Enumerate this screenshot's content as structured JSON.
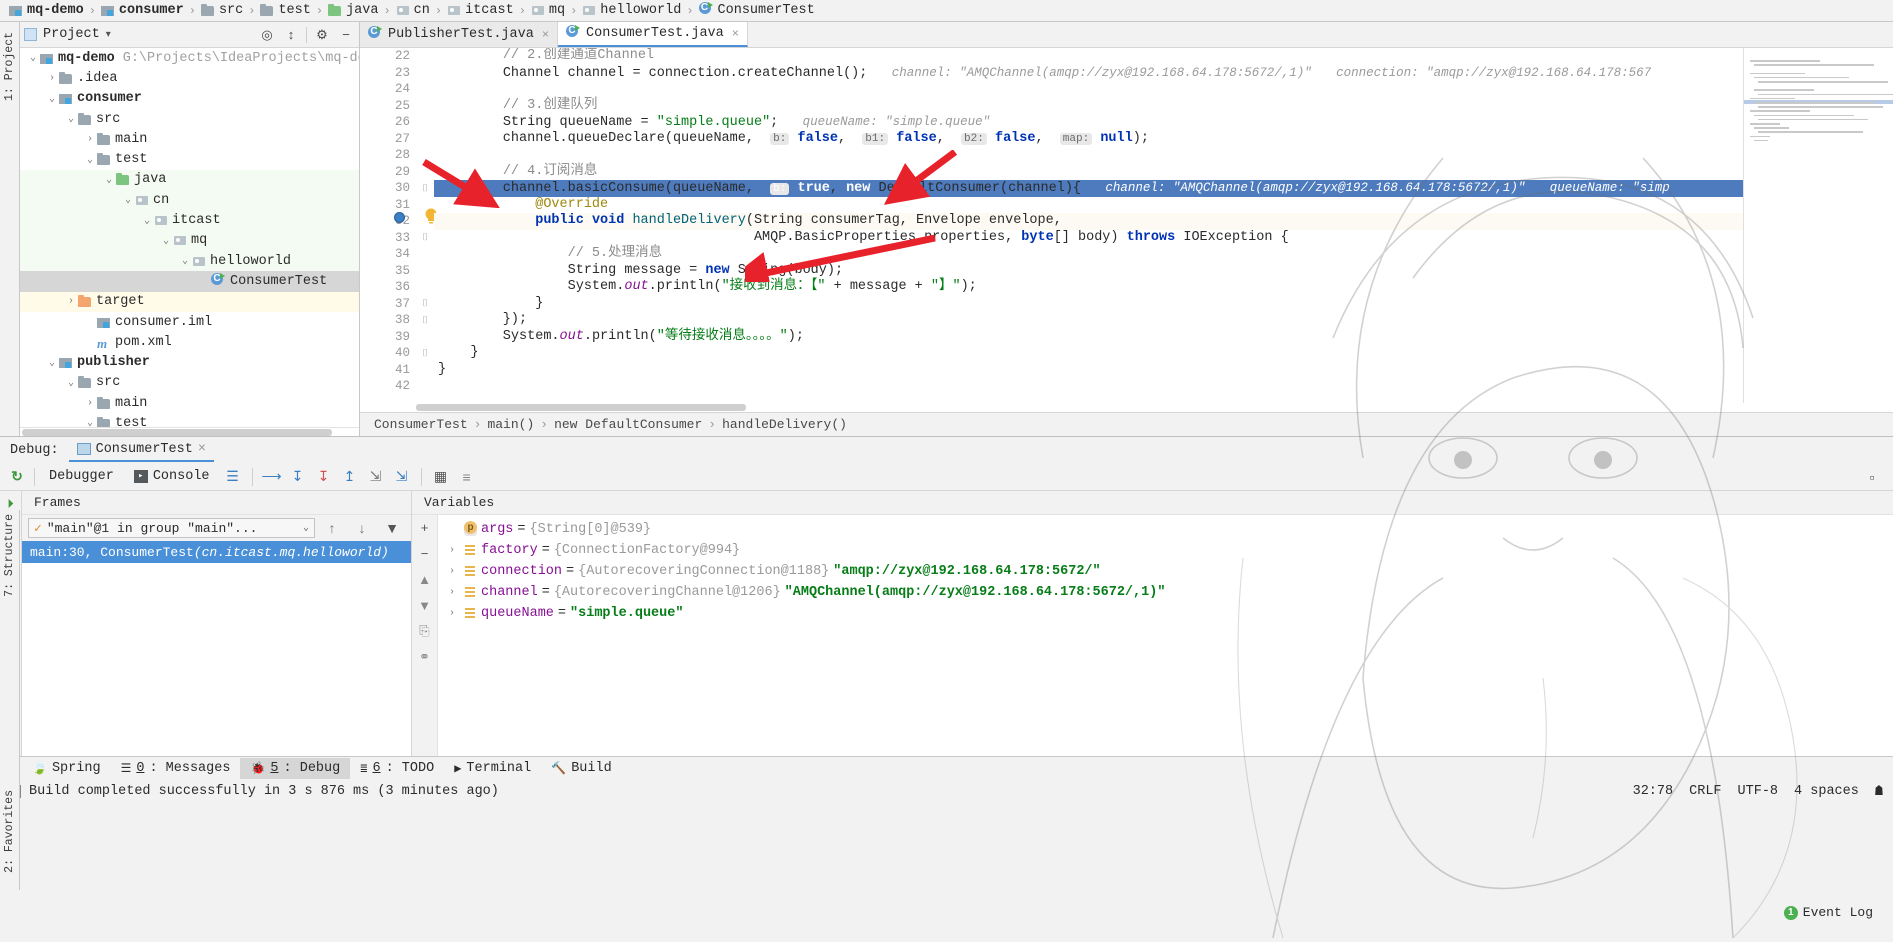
{
  "navbar": {
    "crumbs": [
      {
        "label": "mq-demo",
        "icon": "module-icon",
        "bold": true
      },
      {
        "label": "consumer",
        "icon": "module-icon",
        "bold": true
      },
      {
        "label": "src",
        "icon": "folder-icon",
        "bold": false
      },
      {
        "label": "test",
        "icon": "folder-icon",
        "bold": false
      },
      {
        "label": "java",
        "icon": "folder-green-icon",
        "bold": false
      },
      {
        "label": "cn",
        "icon": "package-icon",
        "bold": false
      },
      {
        "label": "itcast",
        "icon": "package-icon",
        "bold": false
      },
      {
        "label": "mq",
        "icon": "package-icon",
        "bold": false
      },
      {
        "label": "helloworld",
        "icon": "package-icon",
        "bold": false
      },
      {
        "label": "ConsumerTest",
        "icon": "java-class-icon",
        "bold": false
      }
    ],
    "separator": "›"
  },
  "left_strips": {
    "project_label": "1: Project",
    "structure_label": "7: Structure",
    "favorites_label": "2: Favorites"
  },
  "project_panel": {
    "title": "Project",
    "dropdown_caret": "▾",
    "tree": [
      {
        "indent": 0,
        "arrow": "⌄",
        "icon": "module-icon",
        "label": "mq-demo",
        "bold": true,
        "path": "G:\\Projects\\IdeaProjects\\mq-demo",
        "state": "normal"
      },
      {
        "indent": 1,
        "arrow": "›",
        "icon": "folder-icon",
        "label": ".idea",
        "bold": false,
        "path": "",
        "state": "normal"
      },
      {
        "indent": 1,
        "arrow": "⌄",
        "icon": "module-icon",
        "label": "consumer",
        "bold": true,
        "path": "",
        "state": "normal"
      },
      {
        "indent": 2,
        "arrow": "⌄",
        "icon": "folder-icon",
        "label": "src",
        "bold": false,
        "path": "",
        "state": "normal"
      },
      {
        "indent": 3,
        "arrow": "›",
        "icon": "folder-icon",
        "label": "main",
        "bold": false,
        "path": "",
        "state": "normal"
      },
      {
        "indent": 3,
        "arrow": "⌄",
        "icon": "folder-icon",
        "label": "test",
        "bold": false,
        "path": "",
        "state": "normal"
      },
      {
        "indent": 4,
        "arrow": "⌄",
        "icon": "folder-green-icon",
        "label": "java",
        "bold": false,
        "path": "",
        "state": "src"
      },
      {
        "indent": 5,
        "arrow": "⌄",
        "icon": "package-icon",
        "label": "cn",
        "bold": false,
        "path": "",
        "state": "src"
      },
      {
        "indent": 6,
        "arrow": "⌄",
        "icon": "package-icon",
        "label": "itcast",
        "bold": false,
        "path": "",
        "state": "src"
      },
      {
        "indent": 7,
        "arrow": "⌄",
        "icon": "package-icon",
        "label": "mq",
        "bold": false,
        "path": "",
        "state": "src"
      },
      {
        "indent": 8,
        "arrow": "⌄",
        "icon": "package-icon",
        "label": "helloworld",
        "bold": false,
        "path": "",
        "state": "src"
      },
      {
        "indent": 9,
        "arrow": "",
        "icon": "java-class-icon",
        "label": "ConsumerTest",
        "bold": false,
        "path": "",
        "state": "selected"
      },
      {
        "indent": 2,
        "arrow": "›",
        "icon": "folder-orange-icon",
        "label": "target",
        "bold": false,
        "path": "",
        "state": "target"
      },
      {
        "indent": 3,
        "arrow": "",
        "icon": "iml-icon",
        "label": "consumer.iml",
        "bold": false,
        "path": "",
        "state": "normal"
      },
      {
        "indent": 3,
        "arrow": "",
        "icon": "maven-icon",
        "label": "pom.xml",
        "bold": false,
        "path": "",
        "state": "normal"
      },
      {
        "indent": 1,
        "arrow": "⌄",
        "icon": "module-icon",
        "label": "publisher",
        "bold": true,
        "path": "",
        "state": "normal"
      },
      {
        "indent": 2,
        "arrow": "⌄",
        "icon": "folder-icon",
        "label": "src",
        "bold": false,
        "path": "",
        "state": "normal"
      },
      {
        "indent": 3,
        "arrow": "›",
        "icon": "folder-icon",
        "label": "main",
        "bold": false,
        "path": "",
        "state": "normal"
      },
      {
        "indent": 3,
        "arrow": "⌄",
        "icon": "folder-icon",
        "label": "test",
        "bold": false,
        "path": "",
        "state": "normal"
      }
    ]
  },
  "editor": {
    "tabs": [
      {
        "label": "PublisherTest.java",
        "active": false,
        "close": "×"
      },
      {
        "label": "ConsumerTest.java",
        "active": true,
        "close": "×"
      }
    ],
    "first_line_number": 22,
    "lines": [
      {
        "n": 22,
        "state": "normal",
        "html": "        <span class='cmt'>// 2.创建通道Channel</span>"
      },
      {
        "n": 23,
        "state": "normal",
        "html": "        <span class='typ'>Channel</span> channel = connection.createChannel();   <span class='hint'>channel: \"AMQChannel(amqp://zyx@192.168.64.178:5672/,1)\"</span>   <span class='hint'>connection: \"amqp://zyx@192.168.64.178:567</span>"
      },
      {
        "n": 24,
        "state": "normal",
        "html": ""
      },
      {
        "n": 25,
        "state": "normal",
        "html": "        <span class='cmt'>// 3.创建队列</span>"
      },
      {
        "n": 26,
        "state": "normal",
        "html": "        <span class='typ'>String</span> queueName = <span class='str'>\"simple.queue\"</span>;   <span class='hint'>queueName: \"simple.queue\"</span>"
      },
      {
        "n": 27,
        "state": "normal",
        "html": "        channel.queueDeclare(queueName,  <span class='param'>b:</span> <span class='kw'>false</span>,  <span class='param'>b1:</span> <span class='kw'>false</span>,  <span class='param'>b2:</span> <span class='kw'>false</span>,  <span class='param'>map:</span> <span class='kw'>null</span>);"
      },
      {
        "n": 28,
        "state": "normal",
        "html": ""
      },
      {
        "n": 29,
        "state": "normal",
        "html": "        <span class='cmt'>// 4.订阅消息</span>"
      },
      {
        "n": 30,
        "state": "highlight",
        "html": "        channel.basicConsume(queueName,  <span class='param'>b:</span> <span class='kw'>true</span>, <span class='kw'>new</span> DefaultConsumer(channel){   <span class='hint'>channel: \"AMQChannel(amqp://zyx@192.168.64.178:5672/,1)\"</span>   <span class='hint'>queueName: \"simp</span>"
      },
      {
        "n": 31,
        "state": "normal",
        "html": "            <span class='anno'>@Override</span>"
      },
      {
        "n": 32,
        "state": "current",
        "html": "            <span class='kw'>public</span> <span class='kw'>void</span> <span style='color:#00627a'>handleDelivery</span>(<span class='typ'>String</span> consumerTag, <span class='typ'>Envelope</span> envelope,"
      },
      {
        "n": 33,
        "state": "normal",
        "html": "                                       AMQP.BasicProperties properties, <span class='kw'>byte</span>[] body) <span class='kw'>throws</span> <span class='typ'>IOException</span> {"
      },
      {
        "n": 34,
        "state": "normal",
        "html": "                <span class='cmt'>// 5.处理消息</span>"
      },
      {
        "n": 35,
        "state": "normal",
        "html": "                <span class='typ'>String</span> message = <span class='kw'>new</span> String(body);"
      },
      {
        "n": 36,
        "state": "normal",
        "html": "                System.<span class='fld'>out</span>.println(<span class='str'>\"接收到消息：【\"</span> + message + <span class='str'>\"】\"</span>);"
      },
      {
        "n": 37,
        "state": "normal",
        "html": "            }"
      },
      {
        "n": 38,
        "state": "normal",
        "html": "        });"
      },
      {
        "n": 39,
        "state": "normal",
        "html": "        System.<span class='fld'>out</span>.println(<span class='str'>\"等待接收消息。。。。\"</span>);"
      },
      {
        "n": 40,
        "state": "normal",
        "html": "    }"
      },
      {
        "n": 41,
        "state": "normal",
        "html": "}"
      },
      {
        "n": 42,
        "state": "normal",
        "html": ""
      }
    ],
    "breadcrumb": [
      "ConsumerTest",
      "main()",
      "new DefaultConsumer",
      "handleDelivery()"
    ],
    "breadcrumb_separator": "›"
  },
  "debug": {
    "label": "Debug:",
    "session_tab": "ConsumerTest",
    "session_close": "×",
    "tabs": [
      {
        "label": "Debugger",
        "icon": "debugger-icon"
      },
      {
        "label": "Console",
        "icon": "console-icon"
      }
    ],
    "frames_header": "Frames",
    "variables_header": "Variables",
    "thread_selected": "\"main\"@1 in group \"main\"...",
    "thread_caret": "⌄",
    "frames": [
      {
        "label": "main:30, ConsumerTest ",
        "package": "(cn.itcast.mq.helloworld)",
        "selected": true
      }
    ],
    "variables": [
      {
        "twisty": "",
        "icon": "param-icon",
        "name": "args",
        "eq": "=",
        "ref": "{String[0]@539}",
        "str": ""
      },
      {
        "twisty": "›",
        "icon": "object-icon",
        "name": "factory",
        "eq": "=",
        "ref": "{ConnectionFactory@994}",
        "str": ""
      },
      {
        "twisty": "›",
        "icon": "object-icon",
        "name": "connection",
        "eq": "=",
        "ref": "{AutorecoveringConnection@1188}",
        "str": "\"amqp://zyx@192.168.64.178:5672/\""
      },
      {
        "twisty": "›",
        "icon": "object-icon",
        "name": "channel",
        "eq": "=",
        "ref": "{AutorecoveringChannel@1206}",
        "str": "\"AMQChannel(amqp://zyx@192.168.64.178:5672/,1)\""
      },
      {
        "twisty": "›",
        "icon": "object-icon",
        "name": "queueName",
        "eq": "=",
        "ref": "",
        "str": "\"simple.queue\""
      }
    ]
  },
  "bottom_toolwindows": [
    {
      "label": "Spring",
      "mnemonic": "",
      "icon": "spring-icon",
      "active": false
    },
    {
      "label": ": Messages",
      "mnemonic": "0",
      "icon": "messages-icon",
      "active": false
    },
    {
      "label": ": Debug",
      "mnemonic": "5",
      "icon": "debug-icon",
      "active": true
    },
    {
      "label": ": TODO",
      "mnemonic": "6",
      "icon": "todo-icon",
      "active": false
    },
    {
      "label": "Terminal",
      "mnemonic": "",
      "icon": "terminal-icon",
      "active": false
    },
    {
      "label": "Build",
      "mnemonic": "",
      "icon": "build-icon",
      "active": false
    }
  ],
  "statusbar": {
    "message": "Build completed successfully in 3 s 876 ms (3 minutes ago)",
    "message_icon": "build-status-icon",
    "caret_position": "32:78",
    "line_separator": "CRLF",
    "encoding": "UTF-8",
    "indent": "4 spaces",
    "event_log": "Event Log",
    "event_log_count": "1"
  },
  "colors": {
    "accent": "#4a90d9",
    "selection": "#4e7bbd",
    "string": "#067d17",
    "keyword": "#0033b3",
    "comment": "#8c8c8c",
    "hint": "#9a9a9a",
    "arrow_annotation": "#e8222b",
    "panel_bg": "#f2f2f2",
    "editor_bg": "#ffffff"
  }
}
